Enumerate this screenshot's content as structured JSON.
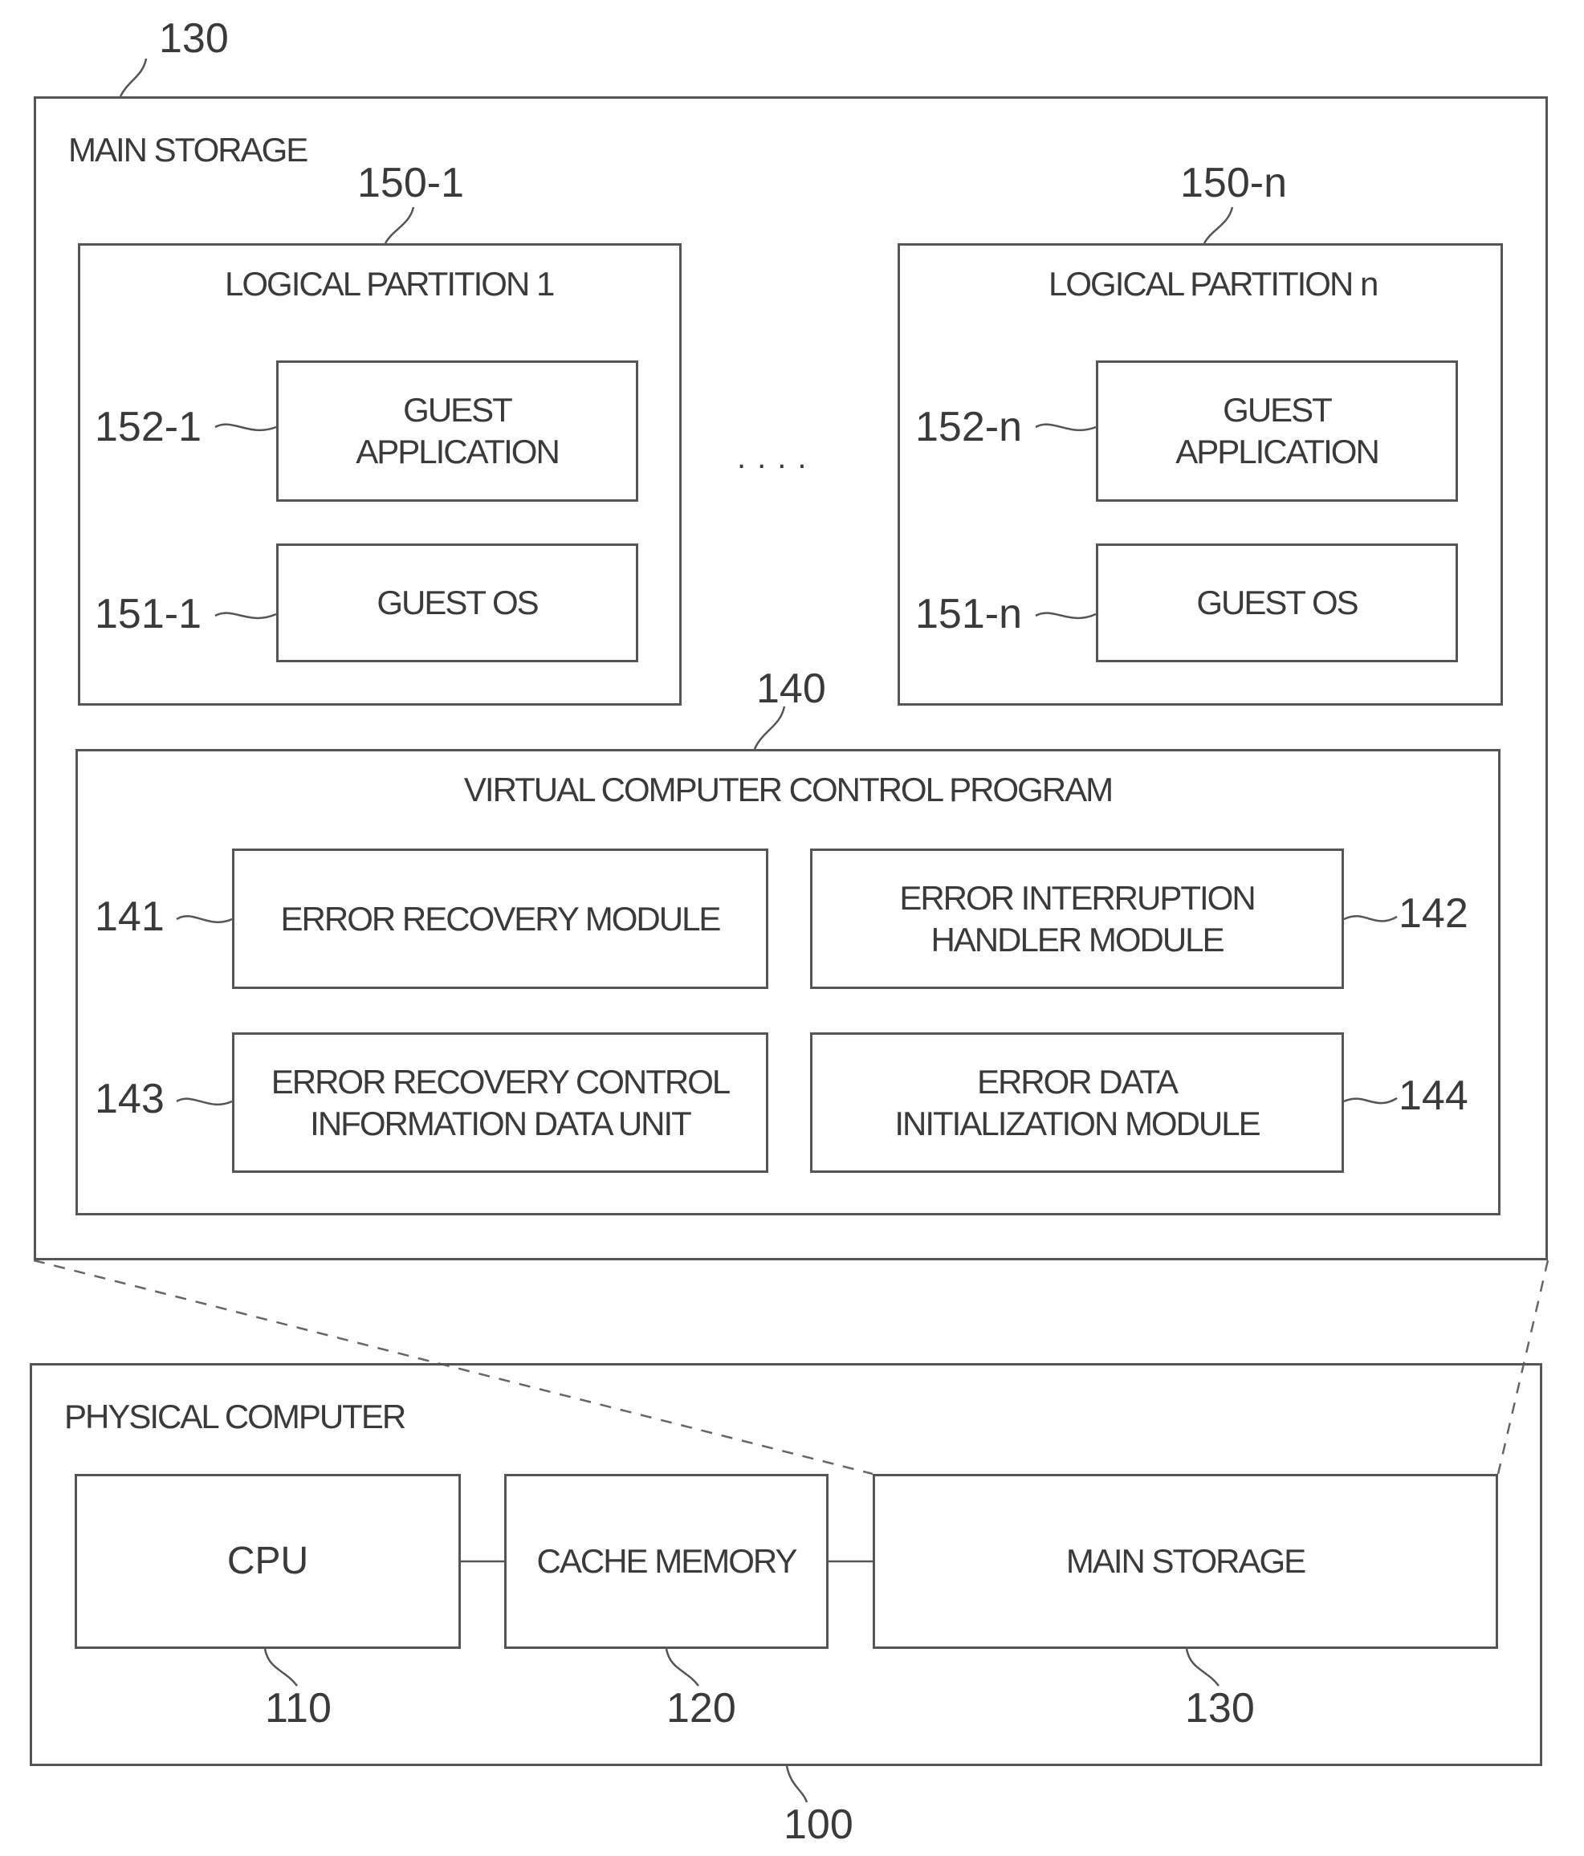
{
  "main_storage": {
    "ref": "130",
    "title": "MAIN STORAGE",
    "partitions": [
      {
        "ref": "150-1",
        "title": "LOGICAL PARTITION 1",
        "guest_app": {
          "ref": "152-1",
          "line1": "GUEST",
          "line2": "APPLICATION"
        },
        "guest_os": {
          "ref": "151-1",
          "label": "GUEST OS"
        }
      },
      {
        "ref": "150-n",
        "title": "LOGICAL PARTITION n",
        "guest_app": {
          "ref": "152-n",
          "line1": "GUEST",
          "line2": "APPLICATION"
        },
        "guest_os": {
          "ref": "151-n",
          "label": "GUEST OS"
        }
      }
    ],
    "ellipsis": "....",
    "vccp": {
      "ref": "140",
      "title": "VIRTUAL COMPUTER CONTROL PROGRAM",
      "modules": [
        {
          "ref": "141",
          "line1": "ERROR RECOVERY MODULE",
          "line2": ""
        },
        {
          "ref": "142",
          "line1": "ERROR INTERRUPTION",
          "line2": "HANDLER MODULE"
        },
        {
          "ref": "143",
          "line1": "ERROR RECOVERY CONTROL",
          "line2": "INFORMATION DATA UNIT"
        },
        {
          "ref": "144",
          "line1": "ERROR DATA",
          "line2": "INITIALIZATION MODULE"
        }
      ]
    }
  },
  "physical_computer": {
    "ref": "100",
    "title": "PHYSICAL COMPUTER",
    "components": [
      {
        "ref": "110",
        "label": "CPU"
      },
      {
        "ref": "120",
        "label": "CACHE MEMORY"
      },
      {
        "ref": "130",
        "label": "MAIN STORAGE"
      }
    ]
  }
}
